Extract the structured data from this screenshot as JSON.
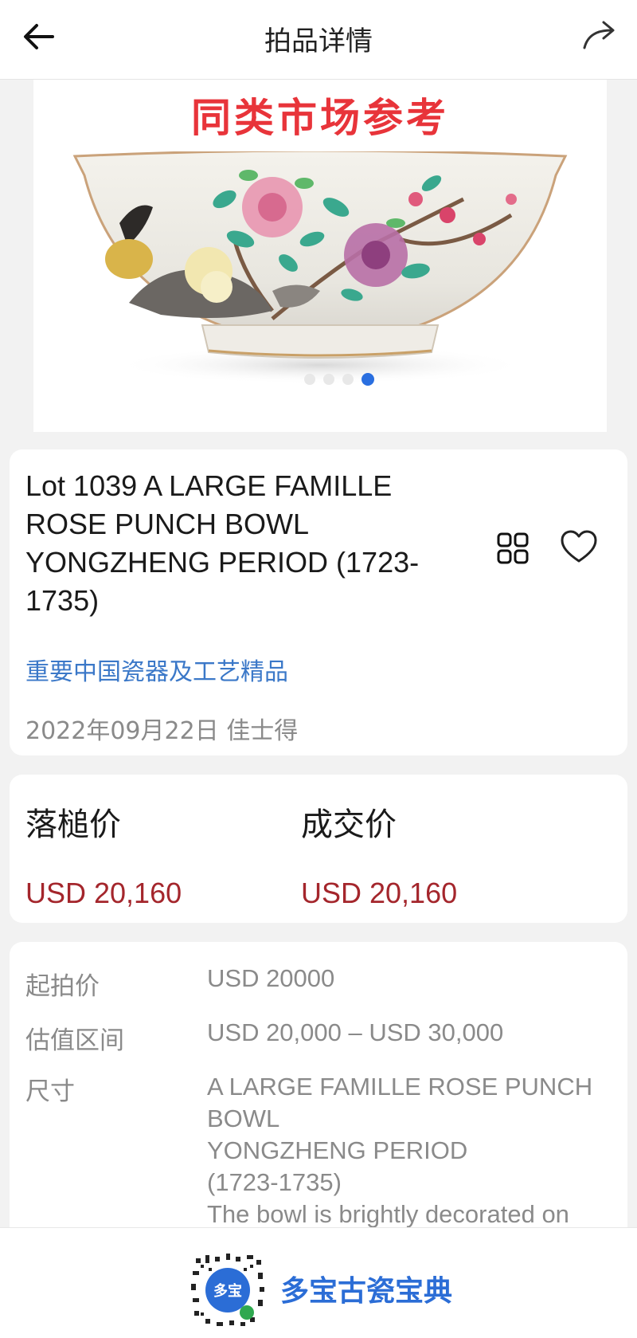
{
  "header": {
    "title": "拍品详情",
    "back_icon": "arrow-left-icon",
    "share_icon": "share-arrow-icon"
  },
  "hero": {
    "banner": "同类市场参考",
    "image_description_icon": "famille-rose-bowl-image",
    "carousel": {
      "count": 4,
      "active_index": 3
    }
  },
  "lot": {
    "title": "Lot 1039 A LARGE FAMILLE ROSE PUNCH BOWL YONGZHENG PERIOD (1723-1735)",
    "sale": "重要中国瓷器及工艺精品",
    "meta": "2022年09月22日 佳士得",
    "grid_icon": "grid-icon",
    "favorite_icon": "heart-icon"
  },
  "prices": {
    "hammer_label": "落槌价",
    "hammer_value": "USD 20,160",
    "deal_label": "成交价",
    "deal_value": "USD 20,160"
  },
  "details": {
    "start_label": "起拍价",
    "start_value": "USD 20000",
    "estimate_label": "估值区间",
    "estimate_value": "USD 20,000 – USD 30,000",
    "size_label": "尺寸",
    "size_value": "A LARGE FAMILLE ROSE PUNCH BOWL\nYONGZHENG PERIOD\n(1723-1735)\nThe bowl is brightly decorated on"
  },
  "footer": {
    "app_name": "多宝古瓷宝典",
    "qr_icon": "mini-program-qr-icon"
  },
  "colors": {
    "banner_red": "#e8343a",
    "price_red": "#a4262c",
    "link_blue": "#3b78c8",
    "footer_blue": "#2b6dd6",
    "carousel_active": "#2a6fe0"
  }
}
